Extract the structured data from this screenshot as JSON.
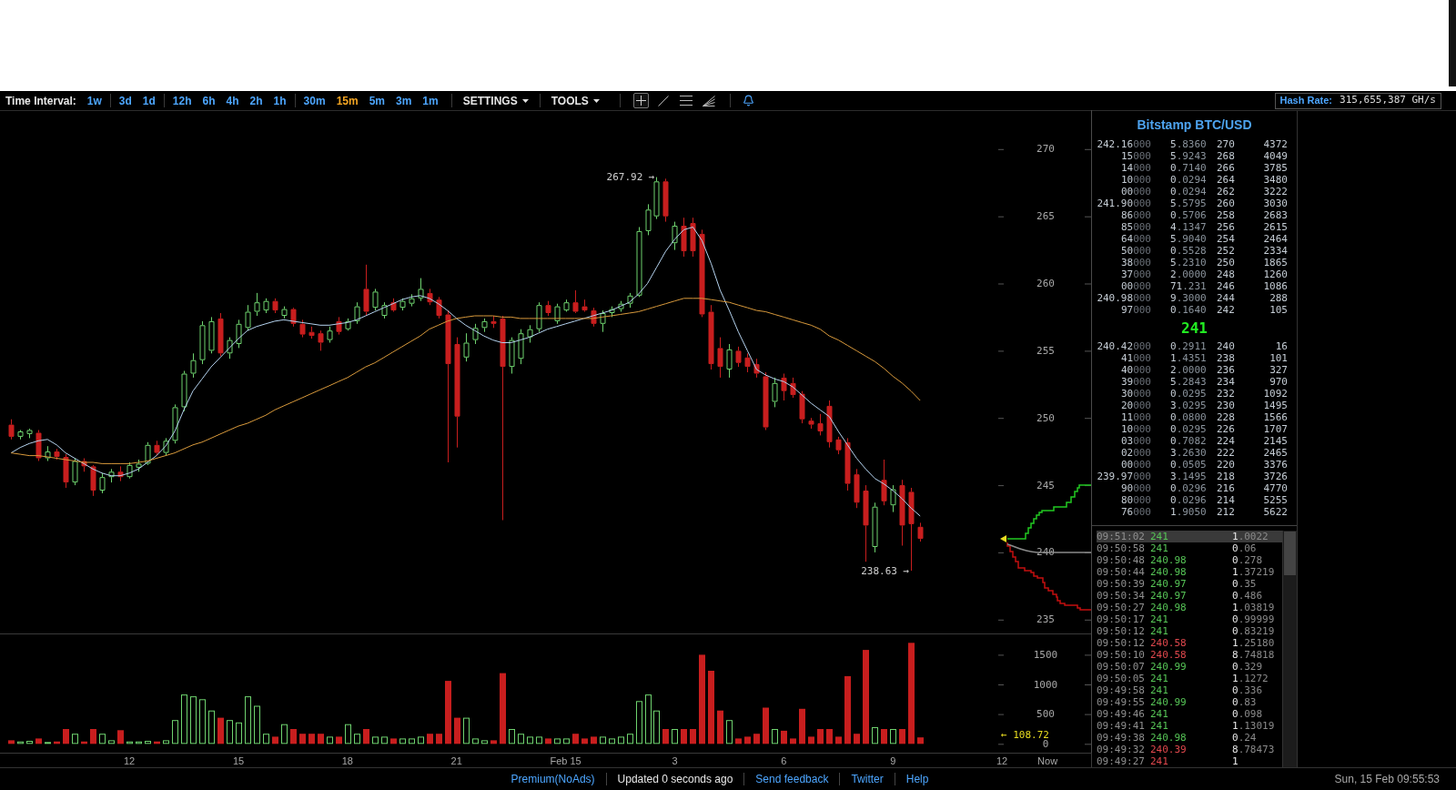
{
  "toolbar": {
    "time_interval_label": "Time Interval:",
    "interval_groups": [
      [
        {
          "label": "1w",
          "selected": false
        }
      ],
      [
        {
          "label": "3d",
          "selected": false
        },
        {
          "label": "1d",
          "selected": false
        }
      ],
      [
        {
          "label": "12h",
          "selected": false
        },
        {
          "label": "6h",
          "selected": false
        },
        {
          "label": "4h",
          "selected": false
        },
        {
          "label": "2h",
          "selected": false
        },
        {
          "label": "1h",
          "selected": false
        }
      ],
      [
        {
          "label": "30m",
          "selected": false
        },
        {
          "label": "15m",
          "selected": true
        },
        {
          "label": "5m",
          "selected": false
        },
        {
          "label": "3m",
          "selected": false
        },
        {
          "label": "1m",
          "selected": false
        }
      ]
    ],
    "menus": [
      {
        "label": "SETTINGS"
      },
      {
        "label": "TOOLS"
      }
    ],
    "tools": [
      {
        "kind": "crosshair",
        "selected": true
      },
      {
        "kind": "trend_line",
        "selected": false
      },
      {
        "kind": "lines",
        "selected": false
      },
      {
        "kind": "fan",
        "selected": false
      }
    ],
    "hash_rate": {
      "label": "Hash Rate:",
      "value": "315,655,387 GH/s"
    }
  },
  "chart": {
    "chart_data": [
      {
        "type": "candlestick",
        "ylim": [
          233.9,
          272.9
        ],
        "yticks": [
          {
            "value": 235,
            "label": "235"
          },
          {
            "value": 240,
            "label": "240"
          },
          {
            "value": 245,
            "label": "245"
          },
          {
            "value": 250,
            "label": "250"
          },
          {
            "value": 255,
            "label": "255"
          },
          {
            "value": 260,
            "label": "260"
          },
          {
            "value": 265,
            "label": "265"
          },
          {
            "value": 270,
            "label": "270"
          }
        ],
        "tick_labels": "y",
        "annotations": [
          "267.92 →",
          "238.63 →"
        ],
        "categories": [
          null,
          null,
          null,
          null,
          null,
          null,
          null,
          null,
          null,
          null,
          null,
          null,
          null,
          null,
          null,
          null,
          null,
          null,
          null,
          null,
          null,
          null,
          null,
          null,
          null,
          null,
          null,
          null,
          null,
          null,
          null,
          null,
          null,
          null,
          null,
          null,
          null,
          null,
          null,
          null,
          null,
          null,
          null,
          null,
          null,
          null,
          null,
          null,
          null,
          null,
          null,
          null,
          null,
          null,
          null,
          null,
          null,
          null,
          null,
          null,
          null,
          null,
          null,
          null,
          null,
          null,
          null,
          null,
          null,
          null,
          null,
          null,
          null,
          null,
          null,
          null,
          null,
          null,
          null,
          null,
          null,
          null,
          null,
          null,
          null,
          null,
          null,
          null,
          null,
          null,
          null,
          null,
          null,
          null,
          null,
          null,
          null,
          null,
          null,
          null,
          null
        ],
        "ohlc": [
          [
            249.5,
            249.9,
            248.4,
            248.6
          ],
          [
            248.6,
            249.1,
            248.4,
            249.0
          ],
          [
            248.8,
            249.2,
            248.5,
            249.1
          ],
          [
            248.9,
            249.1,
            246.8,
            247.0
          ],
          [
            247.0,
            247.9,
            246.8,
            247.5
          ],
          [
            247.5,
            247.7,
            246.9,
            247.1
          ],
          [
            247.1,
            247.3,
            244.8,
            245.2
          ],
          [
            245.2,
            247.0,
            245.0,
            246.8
          ],
          [
            246.8,
            247.0,
            246.0,
            246.4
          ],
          [
            246.4,
            246.5,
            244.2,
            244.6
          ],
          [
            244.6,
            245.9,
            244.4,
            245.6
          ],
          [
            245.6,
            246.2,
            245.2,
            246.0
          ],
          [
            246.0,
            246.4,
            245.3,
            245.6
          ],
          [
            245.6,
            246.7,
            245.5,
            246.5
          ],
          [
            246.3,
            246.9,
            246.0,
            246.6
          ],
          [
            246.6,
            248.2,
            246.5,
            248.0
          ],
          [
            248.0,
            248.3,
            247.2,
            247.4
          ],
          [
            247.4,
            248.5,
            247.2,
            248.3
          ],
          [
            248.3,
            251.0,
            248.1,
            250.8
          ],
          [
            250.8,
            253.5,
            250.5,
            253.3
          ],
          [
            253.3,
            254.8,
            253.0,
            254.3
          ],
          [
            254.3,
            257.2,
            254.0,
            256.9
          ],
          [
            255.0,
            257.5,
            254.8,
            257.2
          ],
          [
            257.4,
            257.8,
            254.6,
            254.8
          ],
          [
            254.8,
            256.0,
            254.4,
            255.8
          ],
          [
            255.5,
            257.3,
            255.2,
            257.0
          ],
          [
            256.7,
            258.4,
            256.5,
            257.9
          ],
          [
            257.9,
            259.3,
            257.6,
            258.6
          ],
          [
            258.0,
            258.9,
            257.8,
            258.7
          ],
          [
            258.7,
            258.9,
            257.8,
            258.0
          ],
          [
            257.6,
            258.3,
            257.4,
            258.1
          ],
          [
            258.1,
            258.2,
            256.8,
            257.0
          ],
          [
            257.0,
            257.3,
            256.0,
            256.2
          ],
          [
            256.4,
            256.8,
            255.9,
            256.1
          ],
          [
            256.3,
            256.5,
            255.0,
            255.6
          ],
          [
            255.8,
            256.8,
            255.6,
            256.5
          ],
          [
            257.2,
            257.5,
            256.2,
            256.4
          ],
          [
            256.6,
            257.4,
            256.5,
            257.2
          ],
          [
            257.2,
            258.6,
            257.0,
            258.3
          ],
          [
            259.6,
            261.4,
            257.6,
            257.9
          ],
          [
            258.2,
            259.6,
            258.0,
            259.4
          ],
          [
            257.6,
            258.6,
            257.4,
            258.4
          ],
          [
            258.6,
            258.9,
            257.9,
            258.0
          ],
          [
            258.2,
            258.9,
            258.0,
            258.7
          ],
          [
            258.5,
            259.2,
            258.3,
            258.9
          ],
          [
            258.9,
            260.4,
            258.7,
            259.6
          ],
          [
            259.3,
            259.6,
            258.4,
            258.6
          ],
          [
            258.8,
            259.0,
            257.4,
            257.6
          ],
          [
            257.7,
            258.0,
            246.7,
            254.0
          ],
          [
            255.5,
            256.0,
            247.8,
            250.1
          ],
          [
            254.5,
            256.3,
            254.2,
            255.6
          ],
          [
            255.8,
            257.0,
            255.5,
            256.7
          ],
          [
            256.7,
            257.4,
            256.4,
            257.2
          ],
          [
            257.2,
            257.6,
            256.7,
            257.0
          ],
          [
            257.4,
            257.6,
            242.4,
            253.8
          ],
          [
            253.8,
            256.0,
            253.3,
            255.8
          ],
          [
            254.4,
            256.6,
            254.0,
            256.3
          ],
          [
            256.0,
            256.9,
            255.6,
            256.6
          ],
          [
            256.6,
            258.6,
            256.4,
            258.4
          ],
          [
            258.4,
            258.7,
            257.6,
            257.8
          ],
          [
            257.2,
            258.5,
            257.0,
            258.3
          ],
          [
            258.0,
            258.8,
            257.9,
            258.6
          ],
          [
            258.6,
            259.5,
            257.8,
            257.9
          ],
          [
            258.3,
            258.8,
            257.9,
            258.0
          ],
          [
            258.0,
            258.2,
            256.8,
            257.0
          ],
          [
            257.0,
            258.0,
            256.4,
            257.8
          ],
          [
            257.8,
            258.3,
            257.5,
            258.1
          ],
          [
            258.1,
            258.7,
            257.9,
            258.5
          ],
          [
            258.5,
            259.3,
            258.2,
            259.1
          ],
          [
            259.1,
            264.2,
            259.0,
            263.9
          ],
          [
            263.9,
            265.9,
            263.6,
            265.5
          ],
          [
            265.0,
            267.92,
            264.8,
            267.6
          ],
          [
            267.6,
            267.8,
            264.6,
            265.0
          ],
          [
            263.0,
            264.6,
            262.5,
            264.3
          ],
          [
            264.3,
            264.9,
            262.0,
            262.4
          ],
          [
            264.5,
            264.9,
            262.0,
            262.4
          ],
          [
            263.7,
            264.0,
            257.5,
            257.7
          ],
          [
            257.9,
            258.4,
            253.6,
            254.0
          ],
          [
            255.2,
            256.0,
            253.0,
            253.8
          ],
          [
            253.6,
            255.5,
            253.0,
            255.1
          ],
          [
            255.0,
            255.3,
            253.8,
            254.1
          ],
          [
            254.5,
            254.8,
            253.4,
            253.8
          ],
          [
            254.0,
            254.4,
            253.0,
            253.3
          ],
          [
            253.1,
            253.4,
            249.1,
            249.3
          ],
          [
            251.2,
            253.0,
            250.8,
            252.6
          ],
          [
            253.0,
            253.3,
            251.3,
            252.0
          ],
          [
            252.6,
            253.0,
            251.5,
            251.7
          ],
          [
            251.8,
            252.0,
            249.6,
            249.9
          ],
          [
            249.8,
            250.0,
            249.2,
            249.5
          ],
          [
            249.6,
            250.3,
            248.7,
            249.0
          ],
          [
            250.9,
            251.3,
            247.8,
            248.2
          ],
          [
            248.4,
            248.6,
            247.3,
            247.6
          ],
          [
            248.2,
            248.5,
            244.6,
            245.1
          ],
          [
            245.8,
            246.2,
            243.3,
            243.7
          ],
          [
            244.6,
            245.0,
            239.3,
            242.0
          ],
          [
            240.4,
            243.7,
            240.0,
            243.4
          ],
          [
            245.4,
            246.9,
            243.5,
            243.8
          ],
          [
            243.5,
            245.0,
            243.0,
            244.7
          ],
          [
            245.0,
            245.4,
            240.5,
            242.0
          ],
          [
            244.5,
            244.8,
            238.63,
            242.1
          ],
          [
            241.9,
            242.2,
            240.8,
            241.0
          ]
        ],
        "series": [
          {
            "type": "line",
            "color": "#b4d2ee",
            "values": [
              247.4,
              247.8,
              248.1,
              248.3,
              248.4,
              248.0,
              247.4,
              247.0,
              246.6,
              246.2,
              245.9,
              245.7,
              245.7,
              245.9,
              246.2,
              246.7,
              247.2,
              247.9,
              249.0,
              250.6,
              252.0,
              252.9,
              253.8,
              254.5,
              255.2,
              255.9,
              256.5,
              256.8,
              257.0,
              257.2,
              257.3,
              257.2,
              257.1,
              257.0,
              256.9,
              256.9,
              257.0,
              257.1,
              257.3,
              257.6,
              257.9,
              258.2,
              258.5,
              258.8,
              259.0,
              259.1,
              258.9,
              258.5,
              258.0,
              257.4,
              256.9,
              256.5,
              256.1,
              255.8,
              255.6,
              255.6,
              255.8,
              256.0,
              256.3,
              256.6,
              256.8,
              257.0,
              257.2,
              257.4,
              257.6,
              257.8,
              258.0,
              258.3,
              258.6,
              259.2,
              260.0,
              261.2,
              262.4,
              263.3,
              264.0,
              264.2,
              263.2,
              261.5,
              259.5,
              258.0,
              256.4,
              255.0,
              253.6,
              253.2,
              252.9,
              252.7,
              252.3,
              251.7,
              251.1,
              250.6,
              250.1,
              249.0,
              248.0,
              247.0,
              246.2,
              245.5,
              245.1,
              244.6,
              244.0,
              243.3,
              242.7
            ]
          },
          {
            "type": "line",
            "color": "#d99a3c",
            "values": [
              247.4,
              247.3,
              247.2,
              247.2,
              247.1,
              247.0,
              246.9,
              246.8,
              246.7,
              246.7,
              246.6,
              246.6,
              246.6,
              246.6,
              246.7,
              246.8,
              247.0,
              247.2,
              247.4,
              247.7,
              248.0,
              248.2,
              248.5,
              248.8,
              249.1,
              249.4,
              249.6,
              249.9,
              250.2,
              250.6,
              250.9,
              251.2,
              251.5,
              251.8,
              252.1,
              252.4,
              252.7,
              253.0,
              253.4,
              253.8,
              254.1,
              254.5,
              254.9,
              255.3,
              255.7,
              256.1,
              256.6,
              256.9,
              257.2,
              257.4,
              257.5,
              257.6,
              257.6,
              257.6,
              257.5,
              257.5,
              257.4,
              257.4,
              257.4,
              257.4,
              257.4,
              257.4,
              257.4,
              257.4,
              257.4,
              257.5,
              257.6,
              257.7,
              257.8,
              257.9,
              258.1,
              258.3,
              258.5,
              258.7,
              258.9,
              258.9,
              258.9,
              258.8,
              258.7,
              258.6,
              258.4,
              258.2,
              258.0,
              257.9,
              257.7,
              257.5,
              257.3,
              257.1,
              256.9,
              256.6,
              256.1,
              255.8,
              255.4,
              255.0,
              254.6,
              254.2,
              253.7,
              253.1,
              252.6,
              252.0,
              251.3
            ]
          }
        ]
      },
      {
        "type": "bar",
        "ylim": [
          -149,
          1858
        ],
        "yticks": [
          0,
          500,
          1000,
          1500
        ],
        "annotations": [
          "← 108.72"
        ],
        "categories": [
          null,
          null,
          null,
          null,
          null,
          null,
          null,
          null,
          null,
          null,
          null,
          null,
          null,
          "12",
          null,
          null,
          null,
          null,
          null,
          null,
          null,
          null,
          null,
          null,
          null,
          "15",
          null,
          null,
          null,
          null,
          null,
          null,
          null,
          null,
          null,
          null,
          null,
          "18",
          null,
          null,
          null,
          null,
          null,
          null,
          null,
          null,
          null,
          null,
          null,
          "21",
          null,
          null,
          null,
          null,
          null,
          null,
          null,
          null,
          null,
          null,
          null,
          "Feb 15",
          null,
          null,
          null,
          null,
          null,
          null,
          null,
          null,
          null,
          null,
          null,
          "3",
          null,
          null,
          null,
          null,
          null,
          null,
          null,
          null,
          null,
          null,
          null,
          "6",
          null,
          null,
          null,
          null,
          null,
          null,
          null,
          null,
          null,
          null,
          null,
          "9",
          null,
          null,
          null,
          null,
          null,
          null,
          null,
          null,
          null,
          null,
          null,
          "12",
          null,
          null,
          null,
          null,
          "Now"
        ],
        "values": [
          60,
          40,
          50,
          90,
          30,
          40,
          250,
          170,
          40,
          250,
          170,
          60,
          230,
          40,
          40,
          50,
          40,
          60,
          400,
          830,
          800,
          750,
          560,
          440,
          400,
          360,
          800,
          640,
          170,
          120,
          330,
          250,
          170,
          170,
          170,
          120,
          120,
          330,
          170,
          250,
          120,
          120,
          90,
          90,
          90,
          120,
          170,
          170,
          1060,
          440,
          440,
          90,
          60,
          60,
          1190,
          250,
          170,
          120,
          120,
          90,
          90,
          90,
          170,
          90,
          120,
          120,
          90,
          120,
          170,
          720,
          830,
          560,
          250,
          250,
          250,
          250,
          1500,
          1230,
          560,
          400,
          90,
          120,
          170,
          610,
          250,
          220,
          90,
          590,
          120,
          250,
          250,
          120,
          1140,
          170,
          1580,
          280,
          250,
          250,
          250,
          1700,
          108.72,
          null,
          null,
          null,
          null,
          null,
          null,
          null,
          null,
          null,
          null,
          null,
          null,
          null,
          null
        ],
        "colors": [
          "#c81e1e",
          "#6fd36f",
          "#6fd36f",
          "#c81e1e",
          "#6fd36f",
          "#c81e1e",
          "#c81e1e",
          "#6fd36f",
          "#c81e1e",
          "#c81e1e",
          "#6fd36f",
          "#6fd36f",
          "#c81e1e",
          "#6fd36f",
          "#6fd36f",
          "#6fd36f",
          "#c81e1e",
          "#6fd36f",
          "#6fd36f",
          "#6fd36f",
          "#6fd36f",
          "#6fd36f",
          "#6fd36f",
          "#c81e1e",
          "#6fd36f",
          "#6fd36f",
          "#6fd36f",
          "#6fd36f",
          "#6fd36f",
          "#c81e1e",
          "#6fd36f",
          "#c81e1e",
          "#c81e1e",
          "#c81e1e",
          "#c81e1e",
          "#6fd36f",
          "#c81e1e",
          "#6fd36f",
          "#6fd36f",
          "#c81e1e",
          "#6fd36f",
          "#6fd36f",
          "#c81e1e",
          "#6fd36f",
          "#6fd36f",
          "#6fd36f",
          "#c81e1e",
          "#c81e1e",
          "#c81e1e",
          "#c81e1e",
          "#6fd36f",
          "#6fd36f",
          "#6fd36f",
          "#c81e1e",
          "#c81e1e",
          "#6fd36f",
          "#6fd36f",
          "#6fd36f",
          "#6fd36f",
          "#c81e1e",
          "#6fd36f",
          "#6fd36f",
          "#c81e1e",
          "#c81e1e",
          "#c81e1e",
          "#6fd36f",
          "#6fd36f",
          "#6fd36f",
          "#6fd36f",
          "#6fd36f",
          "#6fd36f",
          "#6fd36f",
          "#c81e1e",
          "#6fd36f",
          "#c81e1e",
          "#c81e1e",
          "#c81e1e",
          "#c81e1e",
          "#c81e1e",
          "#6fd36f",
          "#c81e1e",
          "#c81e1e",
          "#c81e1e",
          "#c81e1e",
          "#6fd36f",
          "#c81e1e",
          "#c81e1e",
          "#c81e1e",
          "#c81e1e",
          "#c81e1e",
          "#c81e1e",
          "#c81e1e",
          "#c81e1e",
          "#c81e1e",
          "#c81e1e",
          "#6fd36f",
          "#c81e1e",
          "#6fd36f",
          "#c81e1e",
          "#c81e1e",
          "#c81e1e",
          null,
          null,
          null,
          null,
          null,
          null,
          null,
          null,
          null,
          null,
          null,
          null,
          null,
          null
        ]
      }
    ]
  },
  "order_book": {
    "title": "Bitstamp BTC/USD",
    "asks": [
      {
        "price": "242.16000",
        "amount": "5.8360",
        "column_3": "270",
        "column_4": "4372"
      },
      {
        "price": "15000",
        "amount": "5.9243",
        "column_3": "268",
        "column_4": "4049"
      },
      {
        "price": "14000",
        "amount": "0.7140",
        "column_3": "266",
        "column_4": "3785"
      },
      {
        "price": "10000",
        "amount": "0.0294",
        "column_3": "264",
        "column_4": "3480"
      },
      {
        "price": "00000",
        "amount": "0.0294",
        "column_3": "262",
        "column_4": "3222"
      },
      {
        "price": "241.90000",
        "amount": "5.5795",
        "column_3": "260",
        "column_4": "3030"
      },
      {
        "price": "86000",
        "amount": "0.5706",
        "column_3": "258",
        "column_4": "2683"
      },
      {
        "price": "85000",
        "amount": "4.1347",
        "column_3": "256",
        "column_4": "2615"
      },
      {
        "price": "64000",
        "amount": "5.9040",
        "column_3": "254",
        "column_4": "2464"
      },
      {
        "price": "50000",
        "amount": "0.5528",
        "column_3": "252",
        "column_4": "2334"
      },
      {
        "price": "38000",
        "amount": "5.2310",
        "column_3": "250",
        "column_4": "1865"
      },
      {
        "price": "37000",
        "amount": "2.0000",
        "column_3": "248",
        "column_4": "1260"
      },
      {
        "price": "00000",
        "amount": "71.231",
        "column_3": "246",
        "column_4": "1086"
      },
      {
        "price": "240.98000",
        "amount": "9.3000",
        "column_3": "244",
        "column_4": "288"
      },
      {
        "price": "97000",
        "amount": "0.1640",
        "column_3": "242",
        "column_4": "105"
      }
    ],
    "last_price": "241",
    "bids": [
      {
        "price": "240.42000",
        "amount": "0.2911",
        "column_3": "240",
        "column_4": "16"
      },
      {
        "price": "41000",
        "amount": "1.4351",
        "column_3": "238",
        "column_4": "101"
      },
      {
        "price": "40000",
        "amount": "2.0000",
        "column_3": "236",
        "column_4": "327"
      },
      {
        "price": "39000",
        "amount": "5.2843",
        "column_3": "234",
        "column_4": "970"
      },
      {
        "price": "30000",
        "amount": "0.0295",
        "column_3": "232",
        "column_4": "1092"
      },
      {
        "price": "20000",
        "amount": "3.0295",
        "column_3": "230",
        "column_4": "1495"
      },
      {
        "price": "11000",
        "amount": "0.0800",
        "column_3": "228",
        "column_4": "1566"
      },
      {
        "price": "10000",
        "amount": "0.0295",
        "column_3": "226",
        "column_4": "1707"
      },
      {
        "price": "03000",
        "amount": "0.7082",
        "column_3": "224",
        "column_4": "2145"
      },
      {
        "price": "02000",
        "amount": "3.2630",
        "column_3": "222",
        "column_4": "2465"
      },
      {
        "price": "00000",
        "amount": "0.0505",
        "column_3": "220",
        "column_4": "3376"
      },
      {
        "price": "239.97000",
        "amount": "3.1495",
        "column_3": "218",
        "column_4": "3726"
      },
      {
        "price": "90000",
        "amount": "0.0296",
        "column_3": "216",
        "column_4": "4770"
      },
      {
        "price": "80000",
        "amount": "0.0296",
        "column_3": "214",
        "column_4": "5255"
      },
      {
        "price": "76000",
        "amount": "1.9050",
        "column_3": "212",
        "column_4": "5622"
      }
    ]
  },
  "trades": [
    {
      "time": "09:51:02",
      "price": "241",
      "amount": "1.0022",
      "color": "#56c456",
      "selected": true
    },
    {
      "time": "09:50:58",
      "price": "241",
      "amount": "0.06",
      "color": "#56c456",
      "selected": false
    },
    {
      "time": "09:50:48",
      "price": "240.98",
      "amount": "0.278",
      "color": "#56c456",
      "selected": false
    },
    {
      "time": "09:50:44",
      "price": "240.98",
      "amount": "1.37219",
      "color": "#56c456",
      "selected": false
    },
    {
      "time": "09:50:39",
      "price": "240.97",
      "amount": "0.35",
      "color": "#56c456",
      "selected": false
    },
    {
      "time": "09:50:34",
      "price": "240.97",
      "amount": "0.486",
      "color": "#56c456",
      "selected": false
    },
    {
      "time": "09:50:27",
      "price": "240.98",
      "amount": "1.03819",
      "color": "#56c456",
      "selected": false
    },
    {
      "time": "09:50:17",
      "price": "241",
      "amount": "0.99999",
      "color": "#56c456",
      "selected": false
    },
    {
      "time": "09:50:12",
      "price": "241",
      "amount": "0.83219",
      "color": "#56c456",
      "selected": false
    },
    {
      "time": "09:50:12",
      "price": "240.58",
      "amount": "1.25180",
      "color": "#e0484d",
      "selected": false
    },
    {
      "time": "09:50:10",
      "price": "240.58",
      "amount": "8.74818",
      "color": "#e0484d",
      "selected": false
    },
    {
      "time": "09:50:07",
      "price": "240.99",
      "amount": "0.329",
      "color": "#56c456",
      "selected": false
    },
    {
      "time": "09:50:05",
      "price": "241",
      "amount": "1.1272",
      "color": "#56c456",
      "selected": false
    },
    {
      "time": "09:49:58",
      "price": "241",
      "amount": "0.336",
      "color": "#56c456",
      "selected": false
    },
    {
      "time": "09:49:55",
      "price": "240.99",
      "amount": "0.83",
      "color": "#56c456",
      "selected": false
    },
    {
      "time": "09:49:46",
      "price": "241",
      "amount": "0.098",
      "color": "#56c456",
      "selected": false
    },
    {
      "time": "09:49:41",
      "price": "241",
      "amount": "1.13019",
      "color": "#56c456",
      "selected": false
    },
    {
      "time": "09:49:38",
      "price": "240.98",
      "amount": "0.24",
      "color": "#56c456",
      "selected": false
    },
    {
      "time": "09:49:32",
      "price": "240.39",
      "amount": "8.78473",
      "color": "#e0484d",
      "selected": false
    },
    {
      "time": "09:49:27",
      "price": "241",
      "amount": "1",
      "color": "#e0484d",
      "selected": false
    }
  ],
  "footer": {
    "items": [
      {
        "kind": "link",
        "label": "Premium(NoAds)"
      },
      {
        "kind": "text",
        "label": "Updated 0 seconds ago"
      },
      {
        "kind": "link",
        "label": "Send feedback"
      },
      {
        "kind": "link",
        "label": "Twitter"
      },
      {
        "kind": "link",
        "label": "Help"
      }
    ],
    "datetime": "Sun, 15 Feb 09:55:53"
  }
}
